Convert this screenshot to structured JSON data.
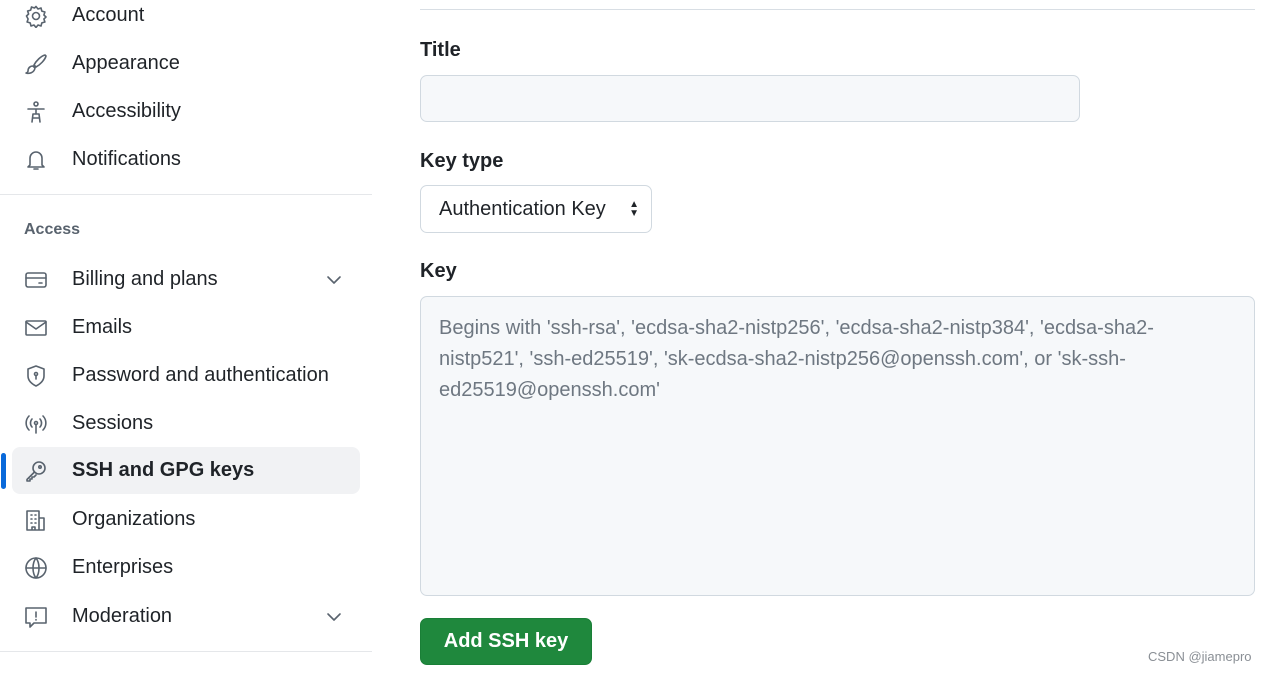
{
  "sidebar": {
    "items_top": [
      {
        "label": "Account",
        "icon": "gear-icon"
      },
      {
        "label": "Appearance",
        "icon": "paintbrush-icon"
      },
      {
        "label": "Accessibility",
        "icon": "accessibility-icon"
      },
      {
        "label": "Notifications",
        "icon": "bell-icon"
      }
    ],
    "section_label": "Access",
    "items_access": [
      {
        "label": "Billing and plans",
        "icon": "credit-card-icon",
        "expandable": true
      },
      {
        "label": "Emails",
        "icon": "mail-icon"
      },
      {
        "label": "Password and authentication",
        "icon": "shield-lock-icon"
      },
      {
        "label": "Sessions",
        "icon": "broadcast-icon"
      },
      {
        "label": "SSH and GPG keys",
        "icon": "key-icon",
        "active": true
      },
      {
        "label": "Organizations",
        "icon": "organization-icon"
      },
      {
        "label": "Enterprises",
        "icon": "globe-icon"
      },
      {
        "label": "Moderation",
        "icon": "report-icon",
        "expandable": true
      }
    ]
  },
  "form": {
    "title_label": "Title",
    "title_value": "",
    "key_type_label": "Key type",
    "key_type_value": "Authentication Key",
    "key_label": "Key",
    "key_placeholder": "Begins with 'ssh-rsa', 'ecdsa-sha2-nistp256', 'ecdsa-sha2-nistp384', 'ecdsa-sha2-nistp521', 'ssh-ed25519', 'sk-ecdsa-sha2-nistp256@openssh.com', or 'sk-ssh-ed25519@openssh.com'",
    "submit_label": "Add SSH key"
  },
  "colors": {
    "accent": "#0969da",
    "primary_button": "#1f883d"
  },
  "watermark": "CSDN @jiamepro"
}
